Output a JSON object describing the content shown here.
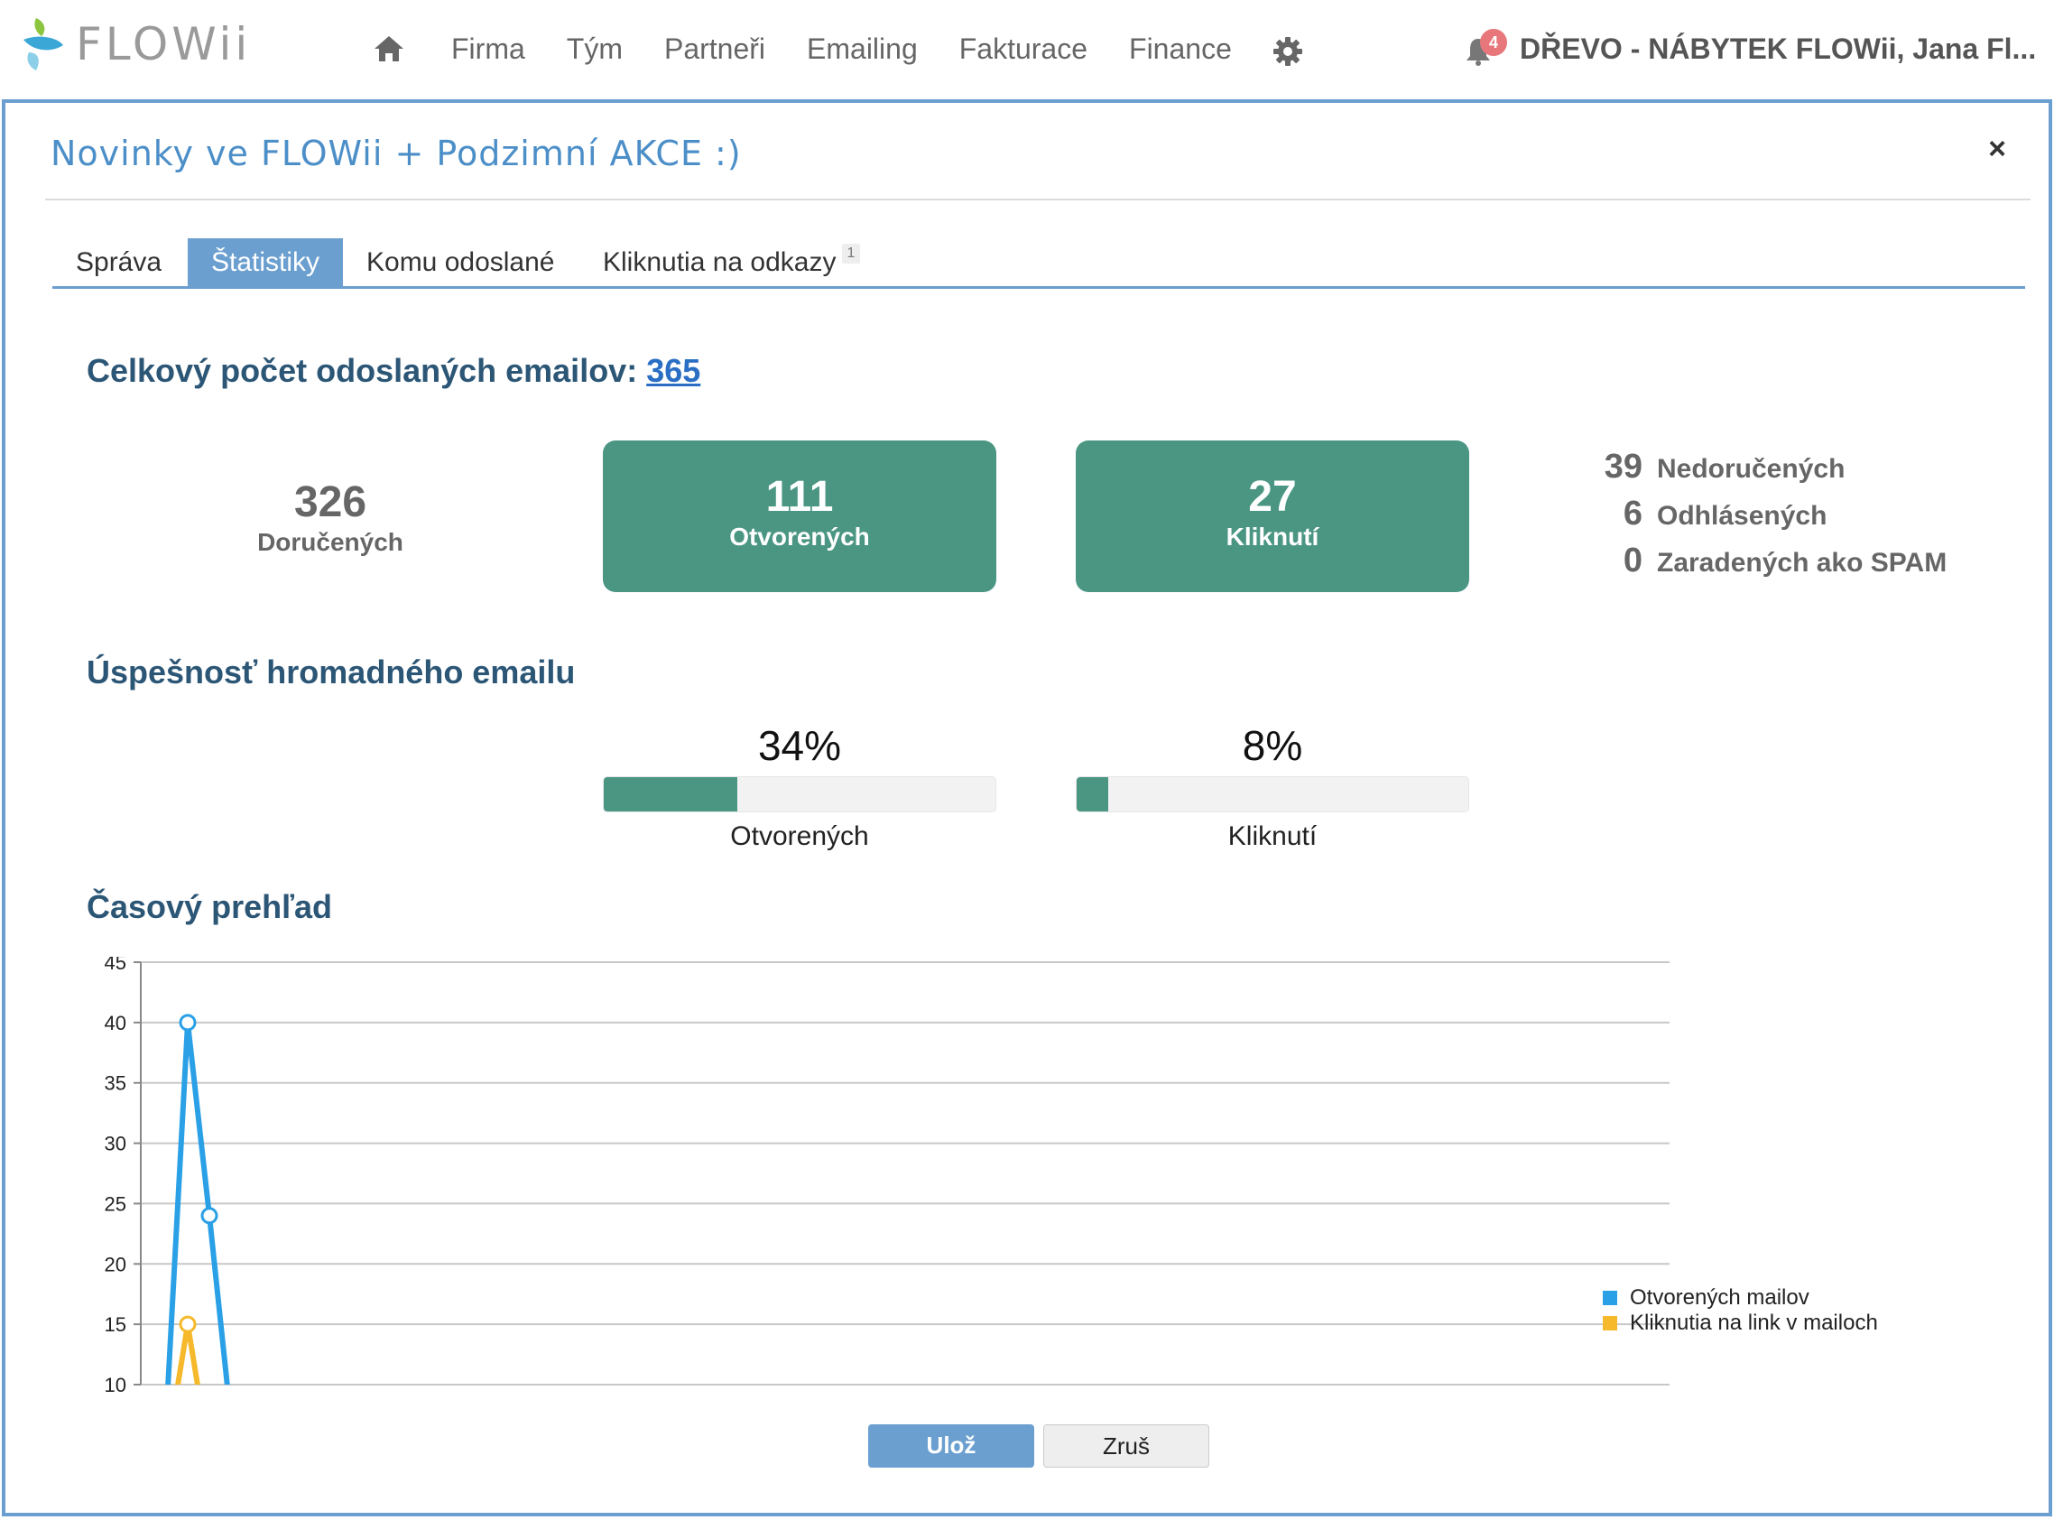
{
  "nav": {
    "logo_text": "FLOWii",
    "items": [
      "Firma",
      "Tým",
      "Partneři",
      "Emailing",
      "Fakturace",
      "Finance"
    ],
    "notification_count": "4",
    "user": "DŘEVO - NÁBYTEK FLOWii, Jana Fl..."
  },
  "modal": {
    "title": "Novinky ve FLOWii + Podzimní AKCE :)",
    "close": "×",
    "tabs": [
      {
        "label": "Správa",
        "active": false
      },
      {
        "label": "Štatistiky",
        "active": true
      },
      {
        "label": "Komu odoslané",
        "active": false
      },
      {
        "label": "Kliknutia na odkazy",
        "active": false,
        "badge": "1"
      }
    ]
  },
  "summary": {
    "heading": "Celkový počet odoslaných emailov:",
    "total": "365",
    "delivered": {
      "value": "326",
      "label": "Doručených"
    },
    "opened": {
      "value": "111",
      "label": "Otvorených"
    },
    "clicked": {
      "value": "27",
      "label": "Kliknutí"
    },
    "side": [
      {
        "value": "39",
        "label": "Nedoručených"
      },
      {
        "value": "6",
        "label": "Odhlásených"
      },
      {
        "value": "0",
        "label": "Zaradených ako SPAM"
      }
    ]
  },
  "success": {
    "heading": "Úspešnosť hromadného emailu",
    "opened": {
      "pct_text": "34%",
      "fraction": 0.34,
      "label": "Otvorených"
    },
    "clicked": {
      "pct_text": "8%",
      "fraction": 0.08,
      "label": "Kliknutí"
    }
  },
  "timeline": {
    "heading": "Časový prehľad"
  },
  "colors": {
    "accent": "#6b9fd0",
    "stat_green": "#4a9683",
    "series_open": "#2aa0e6",
    "series_click": "#f6b92b"
  },
  "chart_data": {
    "type": "line",
    "ylim": [
      10,
      45
    ],
    "yticks": [
      "45",
      "40",
      "35",
      "30",
      "25",
      "20",
      "15",
      "10"
    ],
    "x": [
      0,
      1,
      2,
      3
    ],
    "series": [
      {
        "name": "Otvorených mailov",
        "values": [
          7,
          40,
          24,
          7
        ]
      },
      {
        "name": "Kliknutia na link v mailoch",
        "values": [
          4,
          15,
          4,
          null
        ]
      }
    ],
    "legend": "right",
    "grid": true
  },
  "buttons": {
    "save": "Ulož",
    "cancel": "Zruš"
  }
}
